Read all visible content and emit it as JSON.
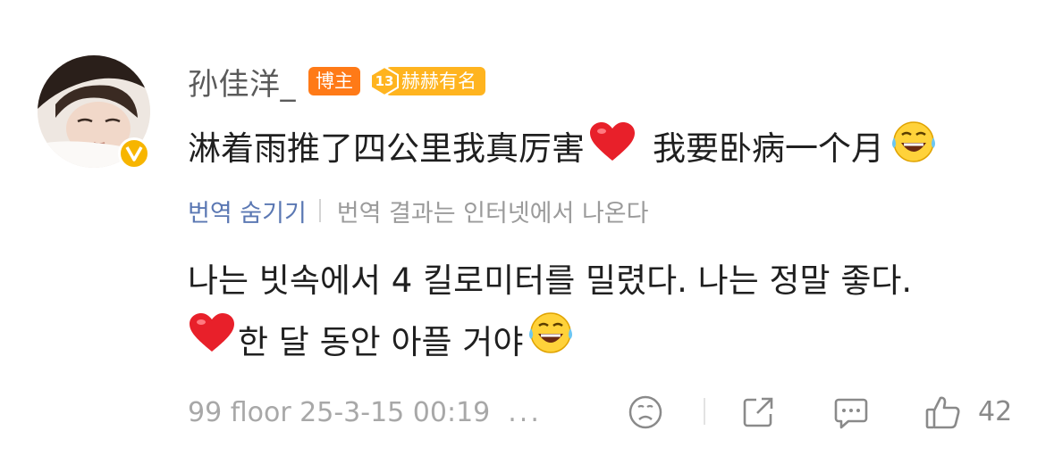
{
  "comment": {
    "username": "孙佳洋_",
    "badges": {
      "blogger": "博主",
      "level_number": "13",
      "level_title": "赫赫有名"
    },
    "content": {
      "part1": "淋着雨推了四公里我真厉害",
      "part2": "我要卧病一个月"
    },
    "translation": {
      "hide_label": "번역 숨기기",
      "note": "번역 결과는 인터넷에서 나온다",
      "line1": "나는 빗속에서 4 킬로미터를 밀렸다. 나는 정말 좋다.",
      "line2": "한 달 동안 아플 거야"
    },
    "footer": {
      "meta": "99 floor 25-3-15 00:19",
      "more": "...",
      "likes": "42"
    },
    "icons": [
      "avatar",
      "verified-icon",
      "heart-emoji",
      "laugh-cry-emoji",
      "sad-face-icon",
      "share-icon",
      "comment-icon",
      "thumbs-up-icon"
    ],
    "colors": {
      "link": "#5b78b3",
      "blogger_badge": "#ff7a17",
      "level_badge": "#ffb41f",
      "verified": "#f7b500",
      "heart": "#e8202a"
    }
  }
}
